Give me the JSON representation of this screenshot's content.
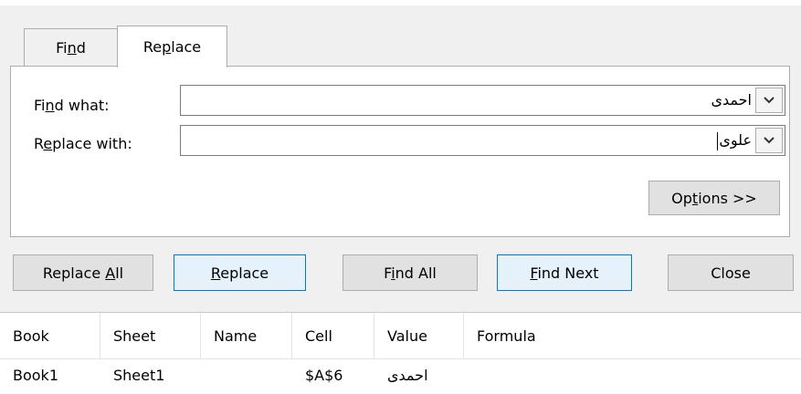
{
  "tabs": {
    "find": {
      "pre": "Fi",
      "accel": "n",
      "post": "d"
    },
    "replace": {
      "pre": "Re",
      "accel": "p",
      "post": "lace"
    }
  },
  "find_what": {
    "label_pre": "Fi",
    "label_accel": "n",
    "label_post": "d what:",
    "value": "احمدی"
  },
  "replace_with": {
    "label_pre": "R",
    "label_accel": "e",
    "label_post": "place with:",
    "value": "علوی"
  },
  "buttons": {
    "options": {
      "pre": "Op",
      "accel": "t",
      "post": "ions >>"
    },
    "replace_all": {
      "pre": "Replace ",
      "accel": "A",
      "post": "ll"
    },
    "replace": {
      "pre": "",
      "accel": "R",
      "post": "eplace"
    },
    "find_all": {
      "pre": "F",
      "accel": "i",
      "post": "nd All"
    },
    "find_next": {
      "pre": "",
      "accel": "F",
      "post": "ind Next"
    },
    "close": {
      "label": "Close"
    }
  },
  "results": {
    "columns": [
      "Book",
      "Sheet",
      "Name",
      "Cell",
      "Value",
      "Formula"
    ],
    "rows": [
      {
        "book": "Book1",
        "sheet": "Sheet1",
        "name": "",
        "cell": "$A$6",
        "value": "احمدی",
        "formula": ""
      }
    ]
  },
  "icons": {
    "dropdown": "chevron-down-icon"
  }
}
